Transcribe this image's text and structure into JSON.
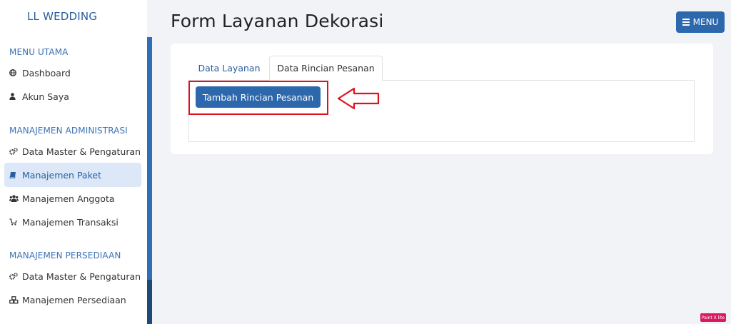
{
  "sidebar": {
    "brand": "LL WEDDING",
    "sections": [
      {
        "title": "MENU UTAMA",
        "items": [
          {
            "label": "Dashboard",
            "icon": "globe-icon"
          },
          {
            "label": "Akun Saya",
            "icon": "user-icon"
          }
        ]
      },
      {
        "title": "MANAJEMEN ADMINISTRASI",
        "items": [
          {
            "label": "Data Master & Pengaturan",
            "icon": "gears-icon"
          },
          {
            "label": "Manajemen Paket",
            "icon": "book-icon",
            "active": true
          },
          {
            "label": "Manajemen Anggota",
            "icon": "users-icon"
          },
          {
            "label": "Manajemen Transaksi",
            "icon": "cart-icon"
          }
        ]
      },
      {
        "title": "MANAJEMEN PERSEDIAAN",
        "items": [
          {
            "label": "Data Master & Pengaturan",
            "icon": "gears-icon"
          },
          {
            "label": "Manajemen Persediaan",
            "icon": "cubes-icon"
          }
        ]
      }
    ]
  },
  "header": {
    "title": "Form Layanan Dekorasi",
    "menu_label": "MENU"
  },
  "tabs": [
    {
      "label": "Data Layanan",
      "active": false
    },
    {
      "label": "Data Rincian Pesanan",
      "active": true
    }
  ],
  "tab_content": {
    "add_button_label": "Tambah Rincian Pesanan"
  },
  "annotation": {
    "color": "#e0111b"
  },
  "watermark": "Paint X lite",
  "colors": {
    "accent": "#2d68ad",
    "active_bg": "#dce8f7",
    "page_bg": "#f1f3f7"
  }
}
